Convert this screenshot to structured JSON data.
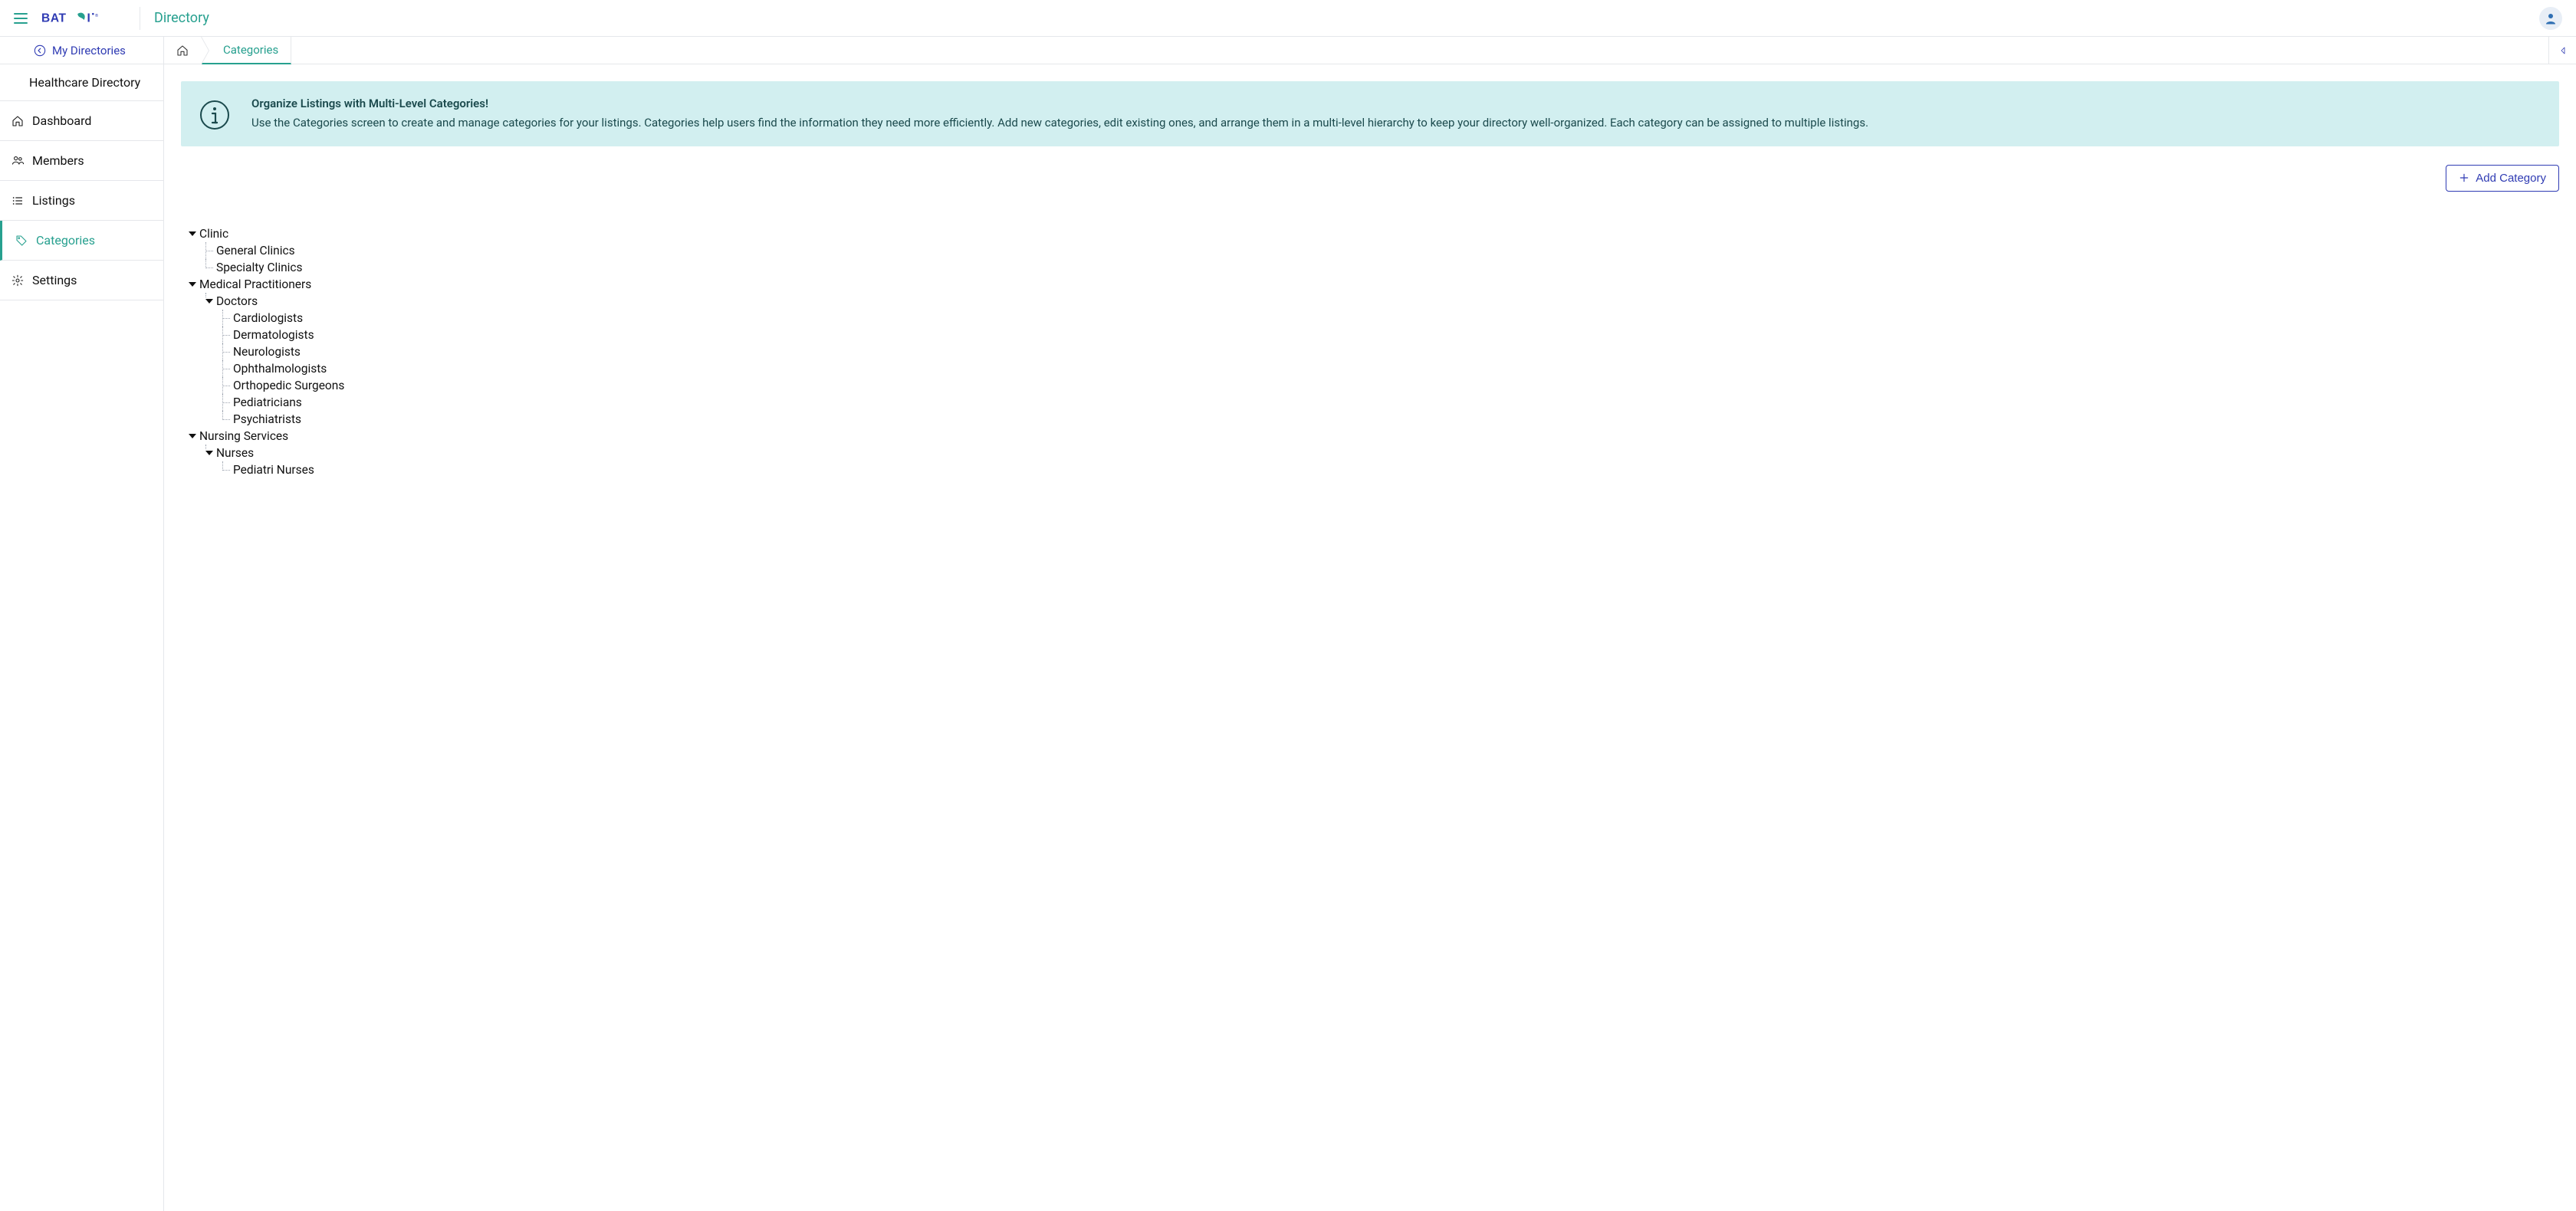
{
  "brand": {
    "name": "BATOI"
  },
  "header": {
    "section": "Directory"
  },
  "secondbar": {
    "back_label": "My Directories"
  },
  "breadcrumb": {
    "home_label": "Home",
    "current": "Categories"
  },
  "context": {
    "title": "Healthcare Directory"
  },
  "nav": {
    "dashboard": "Dashboard",
    "members": "Members",
    "listings": "Listings",
    "categories": "Categories",
    "settings": "Settings"
  },
  "info": {
    "title": "Organize Listings with Multi-Level Categories!",
    "body": "Use the Categories screen to create and manage categories for your listings. Categories help users find the information they need more efficiently. Add new categories, edit existing ones, and arrange them in a multi-level hierarchy to keep your directory well-organized. Each category can be assigned to multiple listings."
  },
  "actions": {
    "add_category": "Add Category"
  },
  "tree": [
    {
      "label": "Clinic",
      "children": [
        {
          "label": "General Clinics"
        },
        {
          "label": "Specialty Clinics"
        }
      ]
    },
    {
      "label": "Medical Practitioners",
      "children": [
        {
          "label": "Doctors",
          "children": [
            {
              "label": "Cardiologists"
            },
            {
              "label": "Dermatologists"
            },
            {
              "label": "Neurologists"
            },
            {
              "label": "Ophthalmologists"
            },
            {
              "label": "Orthopedic Surgeons"
            },
            {
              "label": "Pediatricians"
            },
            {
              "label": "Psychiatrists"
            }
          ]
        }
      ]
    },
    {
      "label": "Nursing Services",
      "children": [
        {
          "label": "Nurses",
          "children": [
            {
              "label": "Pediatri Nurses"
            }
          ]
        }
      ]
    }
  ]
}
